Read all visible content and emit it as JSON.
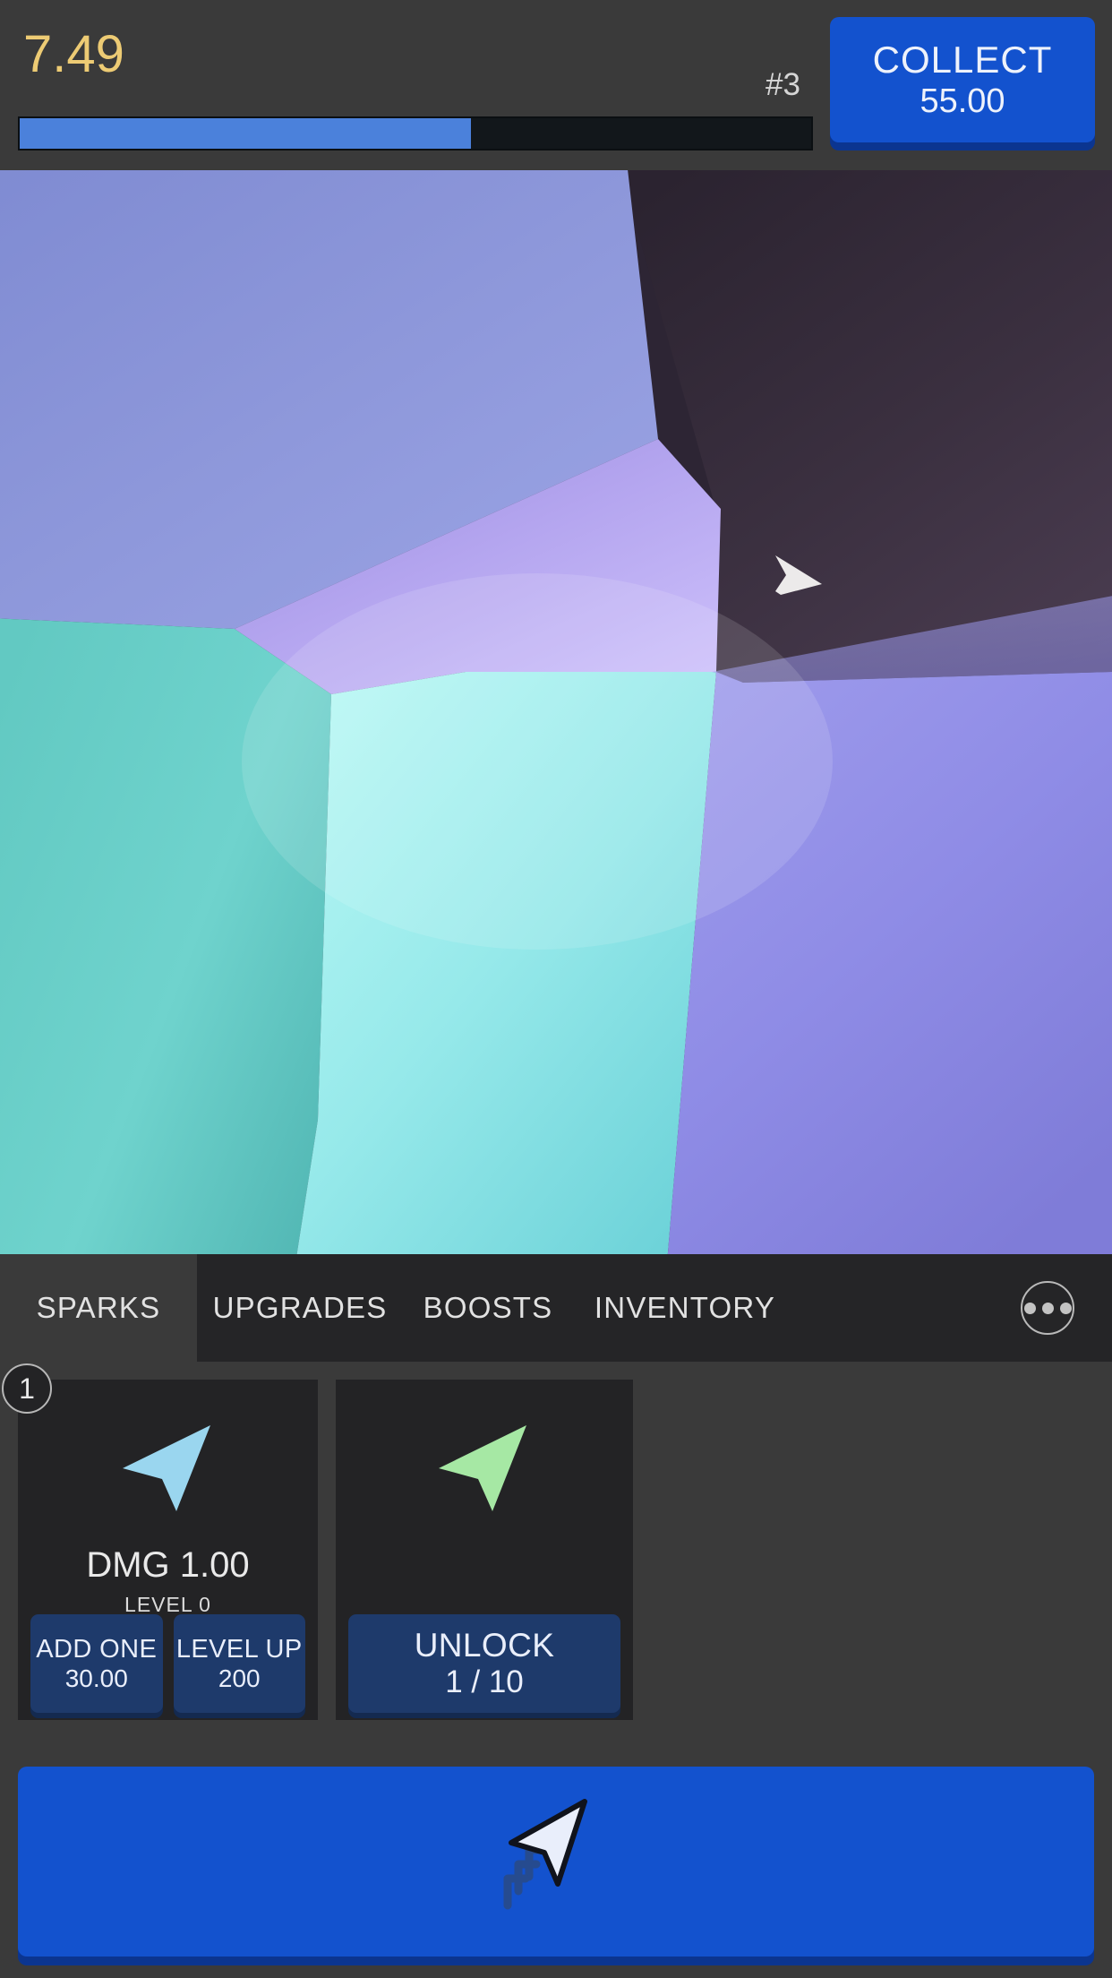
{
  "header": {
    "currency_value": "7.49",
    "rank_label": "#3",
    "progress_percent": 57,
    "progress_fill_color": "#4b81db",
    "progress_track_color": "#12171b",
    "collect": {
      "label": "COLLECT",
      "amount": "55.00",
      "color": "#1352ce",
      "icon": "collect-button"
    }
  },
  "game_view": {
    "name": "crystal-game-viewport",
    "cursor_icon": "spark-arrow-icon",
    "colors": {
      "dark_facet": "#352c3b",
      "periwinkle_facet": "#8a94d6",
      "lavender_facet": "#b8a6ee",
      "teal_facet": "#5fc9c6",
      "cyan_highlight": "#a8f5f2",
      "violet_facet": "#8a87e2"
    }
  },
  "tabs": [
    {
      "id": "sparks",
      "label": "SPARKS",
      "active": true
    },
    {
      "id": "upgrades",
      "label": "UPGRADES",
      "active": false
    },
    {
      "id": "boosts",
      "label": "BOOSTS",
      "active": false
    },
    {
      "id": "inventory",
      "label": "INVENTORY",
      "active": false
    }
  ],
  "more_button": {
    "icon": "ellipsis-icon",
    "label": "More"
  },
  "cards": [
    {
      "badge": "1",
      "arrow_icon": "spark-arrow-icon",
      "arrow_color": "#9ad6ef",
      "title": "DMG 1.00",
      "subtitle": "LEVEL 0",
      "buttons": [
        {
          "label": "ADD ONE",
          "value": "30.00"
        },
        {
          "label": "LEVEL UP",
          "value": "200"
        }
      ]
    },
    {
      "badge": "",
      "arrow_icon": "spark-arrow-icon",
      "arrow_color": "#a6e8a4",
      "title": "",
      "subtitle": "",
      "buttons": [
        {
          "label": "UNLOCK",
          "value": "1 / 10"
        }
      ]
    }
  ],
  "click_button": {
    "icon": "cursor-click-icon",
    "color": "#1352ce",
    "shadow_color": "#0b3590"
  }
}
